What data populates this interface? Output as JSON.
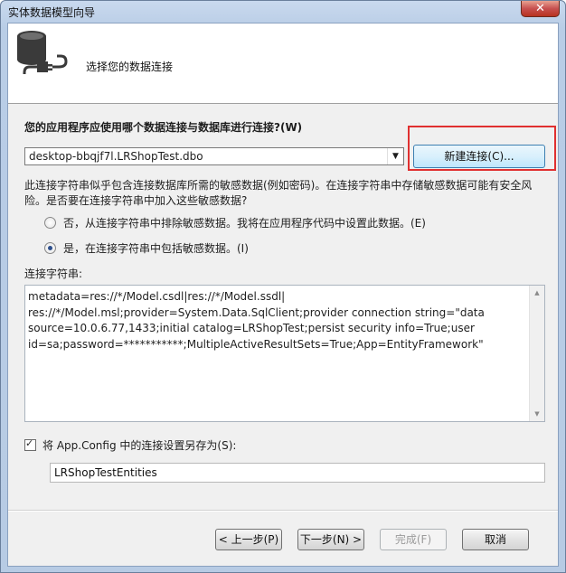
{
  "window": {
    "title": "实体数据模型向导",
    "close_label": "✕"
  },
  "header": {
    "title": "选择您的数据连接"
  },
  "connection": {
    "question": "您的应用程序应使用哪个数据连接与数据库进行连接?(W)",
    "selected": "desktop-bbqjf7l.LRShopTest.dbo",
    "new_connection_label": "新建连接(C)..."
  },
  "sensitive": {
    "warning": "此连接字符串似乎包含连接数据库所需的敏感数据(例如密码)。在连接字符串中存储敏感数据可能有安全风险。是否要在连接字符串中加入这些敏感数据?",
    "option_no": "否，从连接字符串中排除敏感数据。我将在应用程序代码中设置此数据。(E)",
    "option_yes": "是，在连接字符串中包括敏感数据。(I)",
    "selected": "yes"
  },
  "connection_string": {
    "label": "连接字符串:",
    "value": "metadata=res://*/Model.csdl|res://*/Model.ssdl|\nres://*/Model.msl;provider=System.Data.SqlClient;provider connection string=\"data\nsource=10.0.6.77,1433;initial catalog=LRShopTest;persist security info=True;user\nid=sa;password=***********;MultipleActiveResultSets=True;App=EntityFramework\""
  },
  "save_config": {
    "label": "将 App.Config 中的连接设置另存为(S):",
    "checked": true,
    "entity_name": "LRShopTestEntities"
  },
  "footer": {
    "back_label": "< 上一步(P)",
    "next_label": "下一步(N) >",
    "finish_label": "完成(F)",
    "cancel_label": "取消"
  }
}
